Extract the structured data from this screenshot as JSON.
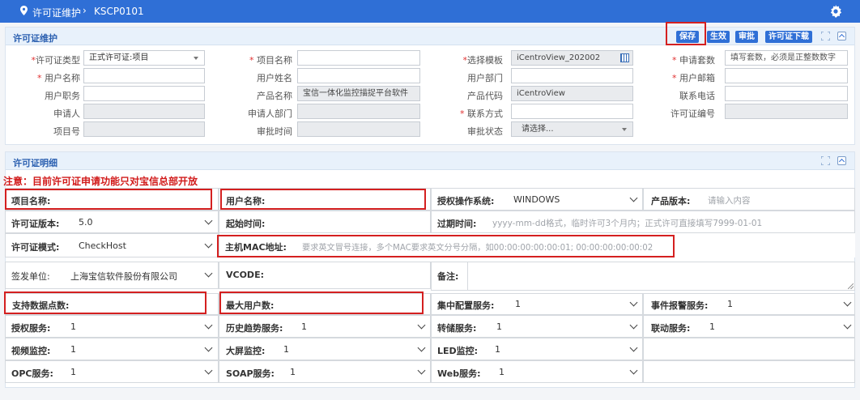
{
  "header": {
    "breadcrumb_title": "许可证维护",
    "breadcrumb_code": "KSCP0101"
  },
  "panel1": {
    "title": "许可证维护",
    "buttons": {
      "save": "保存",
      "activate": "生效",
      "approve": "审批",
      "download": "许可证下载"
    },
    "fields": {
      "license_type": {
        "label": "许可证类型",
        "value": "正式许可证:项目"
      },
      "project_name": {
        "label": "项目名称",
        "value": ""
      },
      "select_template": {
        "label": "选择模板",
        "value": "iCentroView_202002"
      },
      "apply_count": {
        "label": "申请套数",
        "placeholder": "填写套数，必须是正整数数字"
      },
      "user_name": {
        "label": "用户名称",
        "value": ""
      },
      "user_fullname": {
        "label": "用户姓名",
        "value": ""
      },
      "user_dept": {
        "label": "用户部门",
        "value": ""
      },
      "user_email": {
        "label": "用户邮箱",
        "value": ""
      },
      "user_title": {
        "label": "用户职务",
        "value": ""
      },
      "product_name": {
        "label": "产品名称",
        "value": "宝信一体化监控描捉平台软件"
      },
      "product_code": {
        "label": "产品代码",
        "value": "iCentroView"
      },
      "contact_phone": {
        "label": "联系电话",
        "value": ""
      },
      "applicant": {
        "label": "申请人",
        "value": ""
      },
      "applicant_dept": {
        "label": "申请人部门",
        "value": ""
      },
      "contact_method": {
        "label": "联系方式",
        "value": ""
      },
      "license_no": {
        "label": "许可证编号",
        "value": ""
      },
      "project_no": {
        "label": "项目号",
        "value": ""
      },
      "approve_time": {
        "label": "审批时间",
        "value": ""
      },
      "approve_status": {
        "label": "审批状态",
        "value": "请选择..."
      }
    }
  },
  "panel2": {
    "title": "许可证明细",
    "notice": "注意：目前许可证申请功能只对宝信总部开放",
    "fields": {
      "project_name": {
        "label": "项目名称:"
      },
      "user_name": {
        "label": "用户名称:"
      },
      "auth_os": {
        "label": "授权操作系统:",
        "value": "WINDOWS"
      },
      "product_version": {
        "label": "产品版本:",
        "placeholder": "请输入内容"
      },
      "license_version": {
        "label": "许可证版本:",
        "value": "5.0"
      },
      "start_time": {
        "label": "起始时间:"
      },
      "expire_time": {
        "label": "过期时间:",
        "placeholder": "yyyy-mm-dd格式，临时许可3个月内；正式许可直接填写7999-01-01"
      },
      "license_mode": {
        "label": "许可证模式:",
        "value": "CheckHost"
      },
      "mac_address": {
        "label": "主机MAC地址:",
        "placeholder": "要求英文冒号连接，多个MAC要求英文分号分隔，如00:00:00:00:00:01; 00:00:00:00:00:02"
      },
      "issuer": {
        "label": "签发单位:",
        "value": "上海宝信软件股份有限公司"
      },
      "vcode": {
        "label": "VCODE:"
      },
      "remark": {
        "label": "备注:"
      },
      "data_points": {
        "label": "支持数据点数:"
      },
      "max_users": {
        "label": "最大用户数:"
      },
      "central_config": {
        "label": "集中配置服务:",
        "value": "1"
      },
      "event_alarm": {
        "label": "事件报警服务:",
        "value": "1"
      },
      "auth_service": {
        "label": "授权服务:",
        "value": "1"
      },
      "history_trend": {
        "label": "历史趋势服务:",
        "value": "1"
      },
      "storage_service": {
        "label": "转储服务:",
        "value": "1"
      },
      "linkage_service": {
        "label": "联动服务:",
        "value": "1"
      },
      "video_monitor": {
        "label": "视频监控:",
        "value": "1"
      },
      "bigscreen_monitor": {
        "label": "大屏监控:",
        "value": "1"
      },
      "led_monitor": {
        "label": "LED监控:",
        "value": "1"
      },
      "opc_service": {
        "label": "OPC服务:",
        "value": "1"
      },
      "soap_service": {
        "label": "SOAP服务:",
        "value": "1"
      },
      "web_service": {
        "label": "Web服务:",
        "value": "1"
      }
    }
  },
  "colors": {
    "brand": "#2f6fd6",
    "highlight": "#d42020",
    "notice": "#d11a1a"
  }
}
